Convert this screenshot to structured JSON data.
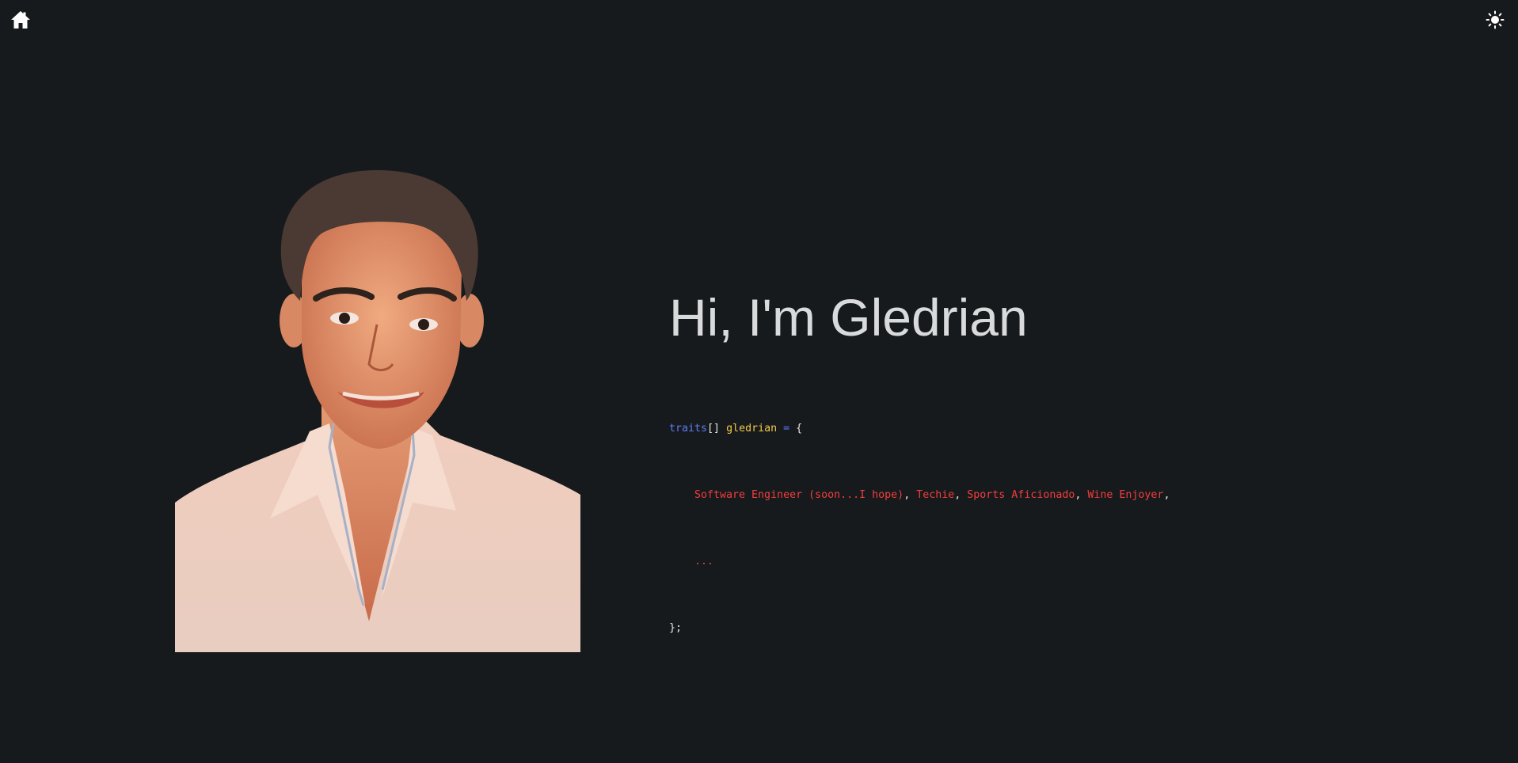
{
  "nav": {
    "home_icon": "home-icon",
    "theme_icon": "sun-icon"
  },
  "hero": {
    "greeting": "Hi, I'm Gledrian",
    "code": {
      "type_keyword": "traits",
      "brackets": "[]",
      "variable": "gledrian",
      "assign": "=",
      "open_brace": "{",
      "traits": [
        "Software Engineer (soon...I hope)",
        "Techie",
        "Sports Aficionado",
        "Wine Enjoyer"
      ],
      "ellipsis": "...",
      "close": "};"
    }
  },
  "colors": {
    "background": "#171a1c",
    "keyword": "#5b7cf5",
    "identifier": "#f2c94c",
    "string": "#f23d3d",
    "text": "#d9dadb"
  }
}
